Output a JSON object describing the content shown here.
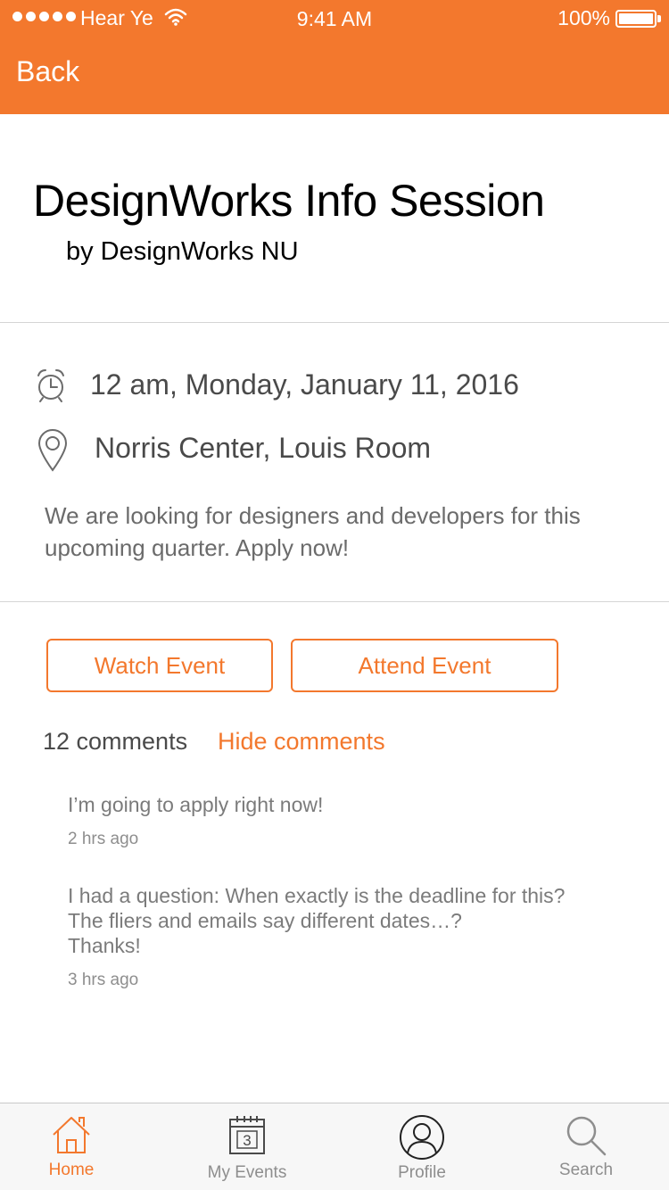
{
  "status_bar": {
    "carrier": "Hear Ye",
    "time": "9:41 AM",
    "battery": "100%"
  },
  "nav": {
    "back_label": "Back"
  },
  "event": {
    "title": "DesignWorks Info Session",
    "organizer": "by DesignWorks NU",
    "datetime": "12 am, Monday, January 11, 2016",
    "location": "Norris Center, Louis Room",
    "description": "We are looking for designers and developers for this upcoming quarter. Apply now!"
  },
  "actions": {
    "watch_label": "Watch Event",
    "attend_label": "Attend Event"
  },
  "comments": {
    "count_label": "12 comments",
    "hide_label": "Hide comments",
    "items": [
      {
        "text": "I’m going to apply right now!",
        "time": "2 hrs ago"
      },
      {
        "text": "I had a question: When exactly is the deadline for this?\nThe fliers and emails say different dates…?\nThanks!",
        "time": "3 hrs ago"
      }
    ]
  },
  "tabs": [
    {
      "label": "Home",
      "icon": "home-icon",
      "active": true
    },
    {
      "label": "My Events",
      "icon": "calendar-icon",
      "calendar_day": "3"
    },
    {
      "label": "Profile",
      "icon": "profile-icon"
    },
    {
      "label": "Search",
      "icon": "search-icon"
    }
  ],
  "colors": {
    "accent": "#F3782D"
  }
}
